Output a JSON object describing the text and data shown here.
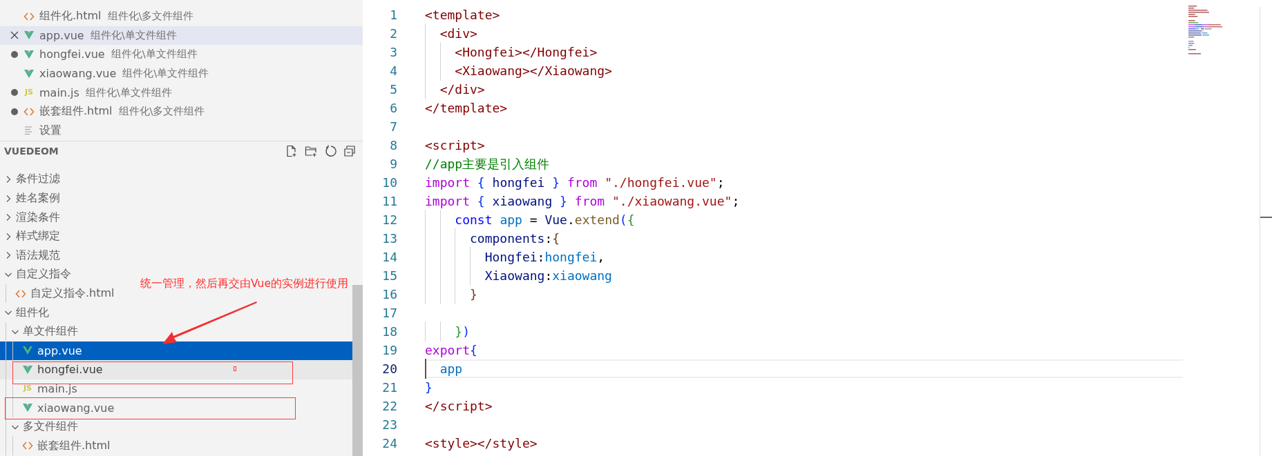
{
  "open_editors": [
    {
      "name": "组件化.html",
      "path": "组件化\\多文件组件",
      "kind": "html",
      "dirty": false,
      "selected": false
    },
    {
      "name": "app.vue",
      "path": "组件化\\单文件组件",
      "kind": "vue",
      "dirty": false,
      "selected": true
    },
    {
      "name": "hongfei.vue",
      "path": "组件化\\单文件组件",
      "kind": "vue",
      "dirty": true,
      "selected": false
    },
    {
      "name": "xiaowang.vue",
      "path": "组件化\\单文件组件",
      "kind": "vue",
      "dirty": false,
      "selected": false
    },
    {
      "name": "main.js",
      "path": "组件化\\单文件组件",
      "kind": "js",
      "icon_text": "JS",
      "dirty": true,
      "selected": false
    },
    {
      "name": "嵌套组件.html",
      "path": "组件化\\多文件组件",
      "kind": "html",
      "dirty": true,
      "selected": false
    },
    {
      "name": "设置",
      "kind": "settings",
      "dirty": false,
      "selected": false
    }
  ],
  "explorer": {
    "title": "VUEDEOM",
    "tree": [
      {
        "label": "条件过滤",
        "kind": "folder",
        "expanded": false
      },
      {
        "label": "姓名案例",
        "kind": "folder",
        "expanded": false
      },
      {
        "label": "渲染条件",
        "kind": "folder",
        "expanded": false
      },
      {
        "label": "样式绑定",
        "kind": "folder",
        "expanded": false
      },
      {
        "label": "语法规范",
        "kind": "folder",
        "expanded": false
      },
      {
        "label": "自定义指令",
        "kind": "folder",
        "expanded": true,
        "children": [
          {
            "label": "自定义指令.html",
            "kind": "html",
            "selected": false,
            "hovered": false
          }
        ]
      },
      {
        "label": "组件化",
        "kind": "folder",
        "expanded": true,
        "children": [
          {
            "label": "单文件组件",
            "kind": "folder",
            "expanded": true,
            "children": [
              {
                "label": "app.vue",
                "kind": "vue",
                "selected": true,
                "hovered": false
              },
              {
                "label": "hongfei.vue",
                "kind": "vue",
                "selected": false,
                "hovered": true
              },
              {
                "label": "main.js",
                "kind": "js",
                "icon_text": "JS",
                "selected": false,
                "hovered": false
              },
              {
                "label": "xiaowang.vue",
                "kind": "vue",
                "selected": false,
                "hovered": false
              }
            ]
          },
          {
            "label": "多文件组件",
            "kind": "folder",
            "expanded": true,
            "children": [
              {
                "label": "嵌套组件.html",
                "kind": "html",
                "selected": false,
                "hovered": false
              }
            ]
          }
        ]
      }
    ]
  },
  "annotation": {
    "text": "统一管理，然后再交由Vue的实例进行使用"
  },
  "code": [
    {
      "number": "1",
      "current": false,
      "tokens": [
        {
          "kind": "tag",
          "text": "<template>"
        }
      ]
    },
    {
      "number": "2",
      "current": false,
      "tokens": [
        {
          "kind": "tag",
          "text": "  <div>"
        }
      ]
    },
    {
      "number": "3",
      "current": false,
      "tokens": [
        {
          "kind": "tag",
          "text": "    <Hongfei></Hongfei>"
        }
      ]
    },
    {
      "number": "4",
      "current": false,
      "tokens": [
        {
          "kind": "tag",
          "text": "    <Xiaowang></Xiaowang>"
        }
      ]
    },
    {
      "number": "5",
      "current": false,
      "tokens": [
        {
          "kind": "tag",
          "text": "  </div>"
        }
      ]
    },
    {
      "number": "6",
      "current": false,
      "tokens": [
        {
          "kind": "tag",
          "text": "</template>"
        }
      ]
    },
    {
      "number": "7",
      "current": false
    },
    {
      "number": "8",
      "current": false,
      "tokens": [
        {
          "kind": "tag",
          "text": "<script>"
        }
      ]
    },
    {
      "number": "9",
      "current": false,
      "tokens": [
        {
          "kind": "comment",
          "text": "//app主要是引入组件"
        }
      ]
    },
    {
      "number": "10",
      "current": false,
      "tokens": [
        {
          "kind": "keyword",
          "text": "import"
        },
        {
          "kind": "bracket1",
          "text": " {"
        },
        {
          "kind": "prop",
          "text": " hongfei"
        },
        {
          "kind": "bracket1",
          "text": " }"
        },
        {
          "kind": "keyword",
          "text": " from"
        },
        {
          "kind": "string",
          "text": " \"./hongfei.vue\""
        },
        {
          "kind": "plain",
          "text": ";"
        }
      ]
    },
    {
      "number": "11",
      "current": false,
      "tokens": [
        {
          "kind": "keyword",
          "text": "import"
        },
        {
          "kind": "bracket1",
          "text": " {"
        },
        {
          "kind": "prop",
          "text": " xiaowang"
        },
        {
          "kind": "bracket1",
          "text": " }"
        },
        {
          "kind": "keyword",
          "text": " from"
        },
        {
          "kind": "string",
          "text": " \"./xiaowang.vue\""
        },
        {
          "kind": "plain",
          "text": ";"
        }
      ]
    },
    {
      "number": "12",
      "current": false,
      "tokens": [
        {
          "kind": "const",
          "text": "    const"
        },
        {
          "kind": "var",
          "text": " app"
        },
        {
          "kind": "plain",
          "text": " ="
        },
        {
          "kind": "prop",
          "text": " Vue"
        },
        {
          "kind": "plain",
          "text": "."
        },
        {
          "kind": "func",
          "text": "extend"
        },
        {
          "kind": "bracket1",
          "text": "("
        },
        {
          "kind": "bracket2",
          "text": "{"
        }
      ]
    },
    {
      "number": "13",
      "current": false,
      "tokens": [
        {
          "kind": "prop",
          "text": "      components"
        },
        {
          "kind": "plain",
          "text": ":"
        },
        {
          "kind": "bracket3",
          "text": "{"
        }
      ]
    },
    {
      "number": "14",
      "current": false,
      "tokens": [
        {
          "kind": "prop",
          "text": "        Hongfei"
        },
        {
          "kind": "plain",
          "text": ":"
        },
        {
          "kind": "var",
          "text": "hongfei"
        },
        {
          "kind": "plain",
          "text": ","
        }
      ]
    },
    {
      "number": "15",
      "current": false,
      "tokens": [
        {
          "kind": "prop",
          "text": "        Xiaowang"
        },
        {
          "kind": "plain",
          "text": ":"
        },
        {
          "kind": "var",
          "text": "xiaowang"
        }
      ]
    },
    {
      "number": "16",
      "current": false,
      "tokens": [
        {
          "kind": "bracket3",
          "text": "      }"
        }
      ]
    },
    {
      "number": "17",
      "current": false
    },
    {
      "number": "18",
      "current": false,
      "tokens": [
        {
          "kind": "bracket2",
          "text": "    }"
        },
        {
          "kind": "bracket1",
          "text": ")"
        }
      ]
    },
    {
      "number": "19",
      "current": false,
      "tokens": [
        {
          "kind": "keyword",
          "text": "export"
        },
        {
          "kind": "bracket1",
          "text": "{"
        }
      ]
    },
    {
      "number": "20",
      "current": true,
      "tokens": [
        {
          "kind": "var",
          "text": "  app"
        }
      ]
    },
    {
      "number": "21",
      "current": false,
      "tokens": [
        {
          "kind": "bracket1",
          "text": "}"
        }
      ]
    },
    {
      "number": "22",
      "current": false,
      "tokens": [
        {
          "kind": "tag",
          "text": "</script>"
        }
      ]
    },
    {
      "number": "23",
      "current": false
    },
    {
      "number": "24",
      "current": false,
      "tokens": [
        {
          "kind": "tag",
          "text": "<style></style>"
        }
      ]
    }
  ]
}
